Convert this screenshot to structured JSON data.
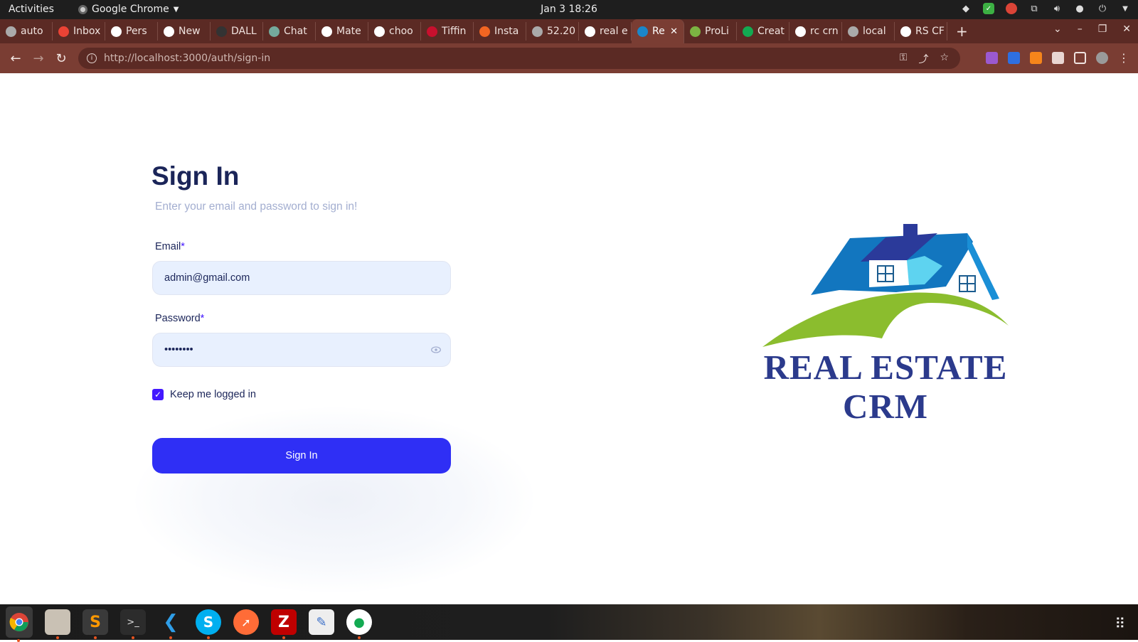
{
  "system": {
    "activities": "Activities",
    "app_name": "Google Chrome",
    "clock": "Jan 3  18:26"
  },
  "browser": {
    "tabs": [
      {
        "label": "auto",
        "color": "#aaaaaa"
      },
      {
        "label": "Inbox",
        "color": "#ea4335"
      },
      {
        "label": "Pers",
        "color": "#ffffff"
      },
      {
        "label": "New",
        "color": "#ffffff"
      },
      {
        "label": "DALL",
        "color": "#333333"
      },
      {
        "label": "Chat",
        "color": "#74aa9c"
      },
      {
        "label": "Mate",
        "color": "#ffffff"
      },
      {
        "label": "choo",
        "color": "#ffffff"
      },
      {
        "label": "Tiffin",
        "color": "#c8102e"
      },
      {
        "label": "Insta",
        "color": "#f16522"
      },
      {
        "label": "52.20",
        "color": "#aaaaaa"
      },
      {
        "label": "real e",
        "color": "#ffffff"
      },
      {
        "label": "Re",
        "color": "#1b86c9",
        "active": true
      },
      {
        "label": "ProLi",
        "color": "#7cb342"
      },
      {
        "label": "Creat",
        "color": "#13aa52"
      },
      {
        "label": "rc crn",
        "color": "#ffffff"
      },
      {
        "label": "local",
        "color": "#aaaaaa"
      },
      {
        "label": "RS CF",
        "color": "#ffffff"
      }
    ],
    "url_host": "http://localhost",
    "url_rest": ":3000/auth/sign-in"
  },
  "signin": {
    "title": "Sign In",
    "subtitle": "Enter your email and password to sign in!",
    "email_label": "Email",
    "password_label": "Password",
    "required_mark": "*",
    "email_value": "admin@gmail.com",
    "password_value": "••••••••",
    "keep_logged_in": "Keep me logged in",
    "button_label": "Sign In"
  },
  "logo": {
    "line1": "REAL ESTATE",
    "line2": "CRM"
  },
  "dock": {
    "apps": [
      "chrome-icon",
      "files-icon",
      "sublime-text-icon",
      "terminal-icon",
      "vscode-icon",
      "skype-icon",
      "postman-icon",
      "filezilla-icon",
      "text-editor-icon",
      "mongodb-compass-icon"
    ]
  }
}
